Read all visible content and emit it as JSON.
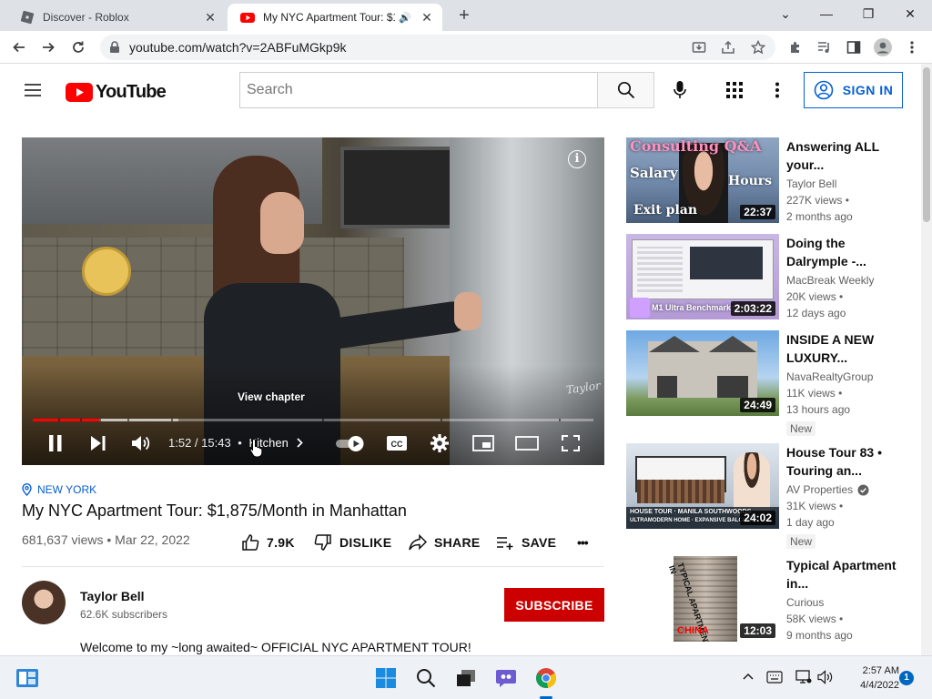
{
  "browser": {
    "tabs": [
      {
        "title": "Discover - Roblox",
        "active": false
      },
      {
        "title": "My NYC Apartment Tour: $1",
        "active": true,
        "audio": true
      }
    ],
    "url": "youtube.com/watch?v=2ABFuMGkp9k"
  },
  "youtube": {
    "logo_text": "YouTube",
    "search": {
      "placeholder": "Search",
      "value": ""
    },
    "signin_label": "SIGN IN",
    "accent": "#065fd4",
    "brand_red": "#ff0000"
  },
  "player": {
    "current_time": "1:52",
    "duration": "15:43",
    "time_display": "1:52 / 15:43",
    "chapter": "Kitchen",
    "view_chapter_label": "View chapter",
    "info_label": "i",
    "watermark": "Taylor",
    "progress_played_pct": 11.9,
    "progress_buffered_pct": 26,
    "autoplay": true
  },
  "video": {
    "location_tag": "NEW YORK",
    "title": "My NYC Apartment Tour: $1,875/Month in Manhattan",
    "meta": "681,637 views • Mar 22, 2022",
    "likes": "7.9K",
    "dislike_label": "DISLIKE",
    "share_label": "SHARE",
    "save_label": "SAVE",
    "more_label": "•••"
  },
  "channel": {
    "name": "Taylor Bell",
    "subscribers": "62.6K subscribers",
    "subscribe_label": "SUBSCRIBE",
    "description": "Welcome to my ~long awaited~ OFFICIAL NYC APARTMENT TOUR!"
  },
  "recommendations": [
    {
      "title": "Answering ALL your...",
      "channel": "Taylor Bell",
      "views": "227K views •",
      "age": "2 months ago",
      "duration": "22:37",
      "thumb_text": [
        "Consulting Q&A",
        "Salary",
        "Hours",
        "Exit plan"
      ]
    },
    {
      "title": "Doing the Dalrymple -...",
      "channel": "MacBreak Weekly",
      "views": "20K views •",
      "age": "12 days ago",
      "duration": "2:03:22",
      "thumb_text": [
        "M1 Ultra Benchmarks"
      ]
    },
    {
      "title": "INSIDE A NEW LUXURY...",
      "channel": "NavaRealtyGroup",
      "views": "11K views •",
      "age": "13 hours ago",
      "badge": "New",
      "duration": "24:49"
    },
    {
      "title": "House Tour 83 • Touring an...",
      "channel": "AV Properties",
      "verified": true,
      "views": "31K views •",
      "age": "1 day ago",
      "badge": "New",
      "duration": "24:02",
      "thumb_text": [
        "HOUSE TOUR · MANILA SOUTHWOODS",
        "ULTRAMODERN HOME · EXPANSIVE BALCONY"
      ]
    },
    {
      "title": "Typical Apartment in...",
      "channel": "Curious",
      "views": "58K views •",
      "age": "9 months ago",
      "duration": "12:03",
      "thumb_text": [
        "TYPICAL APARTMENT IN",
        "CHINA"
      ]
    }
  ],
  "taskbar": {
    "time": "2:57 AM",
    "date": "4/4/2022",
    "notification_count": "1"
  }
}
